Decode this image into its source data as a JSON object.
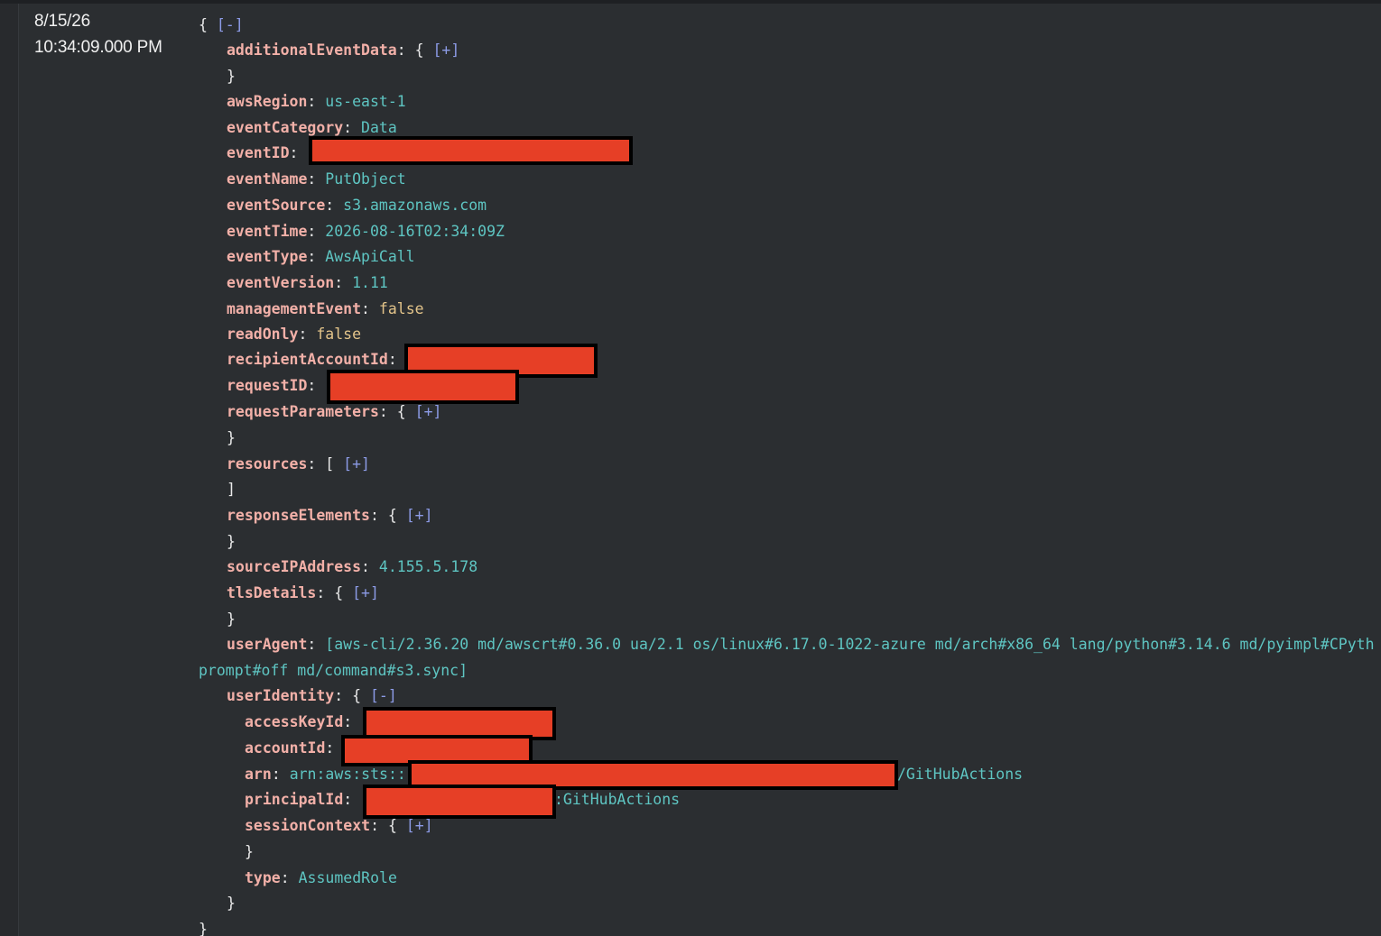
{
  "timestamp": {
    "date": "8/15/26",
    "time": "10:34:09.000 PM"
  },
  "toggles": {
    "collapse": "[-]",
    "expand": "[+]"
  },
  "event": {
    "open_brace": "{",
    "close_brace": "}",
    "additionalEventData": {
      "key": "additionalEventData",
      "open": "{",
      "close": "}"
    },
    "awsRegion": {
      "key": "awsRegion",
      "value": "us-east-1"
    },
    "eventCategory": {
      "key": "eventCategory",
      "value": "Data"
    },
    "eventID": {
      "key": "eventID"
    },
    "eventName": {
      "key": "eventName",
      "value": "PutObject"
    },
    "eventSource": {
      "key": "eventSource",
      "value": "s3.amazonaws.com"
    },
    "eventTime": {
      "key": "eventTime",
      "value": "2026-08-16T02:34:09Z"
    },
    "eventType": {
      "key": "eventType",
      "value": "AwsApiCall"
    },
    "eventVersion": {
      "key": "eventVersion",
      "value": "1.11"
    },
    "managementEvent": {
      "key": "managementEvent",
      "value": "false"
    },
    "readOnly": {
      "key": "readOnly",
      "value": "false"
    },
    "recipientAccountId": {
      "key": "recipientAccountId"
    },
    "requestID": {
      "key": "requestID"
    },
    "requestParameters": {
      "key": "requestParameters",
      "open": "{",
      "close": "}"
    },
    "resources": {
      "key": "resources",
      "open": "[",
      "close": "]"
    },
    "responseElements": {
      "key": "responseElements",
      "open": "{",
      "close": "}"
    },
    "sourceIPAddress": {
      "key": "sourceIPAddress",
      "value": "4.155.5.178"
    },
    "tlsDetails": {
      "key": "tlsDetails",
      "open": "{",
      "close": "}"
    },
    "userAgent": {
      "key": "userAgent",
      "value_line1": "[aws-cli/2.36.20 md/awscrt#0.36.0 ua/2.1 os/linux#6.17.0-1022-azure md/arch#x86_64 lang/python#3.14.6 md/pyimpl#CPyth",
      "value_line2": "prompt#off md/command#s3.sync]"
    },
    "userIdentity": {
      "key": "userIdentity",
      "open": "{",
      "close": "}",
      "accessKeyId": {
        "key": "accessKeyId"
      },
      "accountId": {
        "key": "accountId"
      },
      "arn": {
        "key": "arn",
        "value_prefix": "arn:aws:sts::",
        "value_suffix": "/GitHubActions"
      },
      "principalId": {
        "key": "principalId",
        "value_suffix": ":GitHubActions"
      },
      "sessionContext": {
        "key": "sessionContext",
        "open": "{",
        "close": "}"
      },
      "type": {
        "key": "type",
        "value": "AssumedRole"
      }
    }
  },
  "colors": {
    "background": "#2b2e31",
    "key": "#f2b0a8",
    "string": "#5ec5c2",
    "boolean": "#e3c48a",
    "toggle": "#8c9be6",
    "redaction": "#e63f26"
  }
}
